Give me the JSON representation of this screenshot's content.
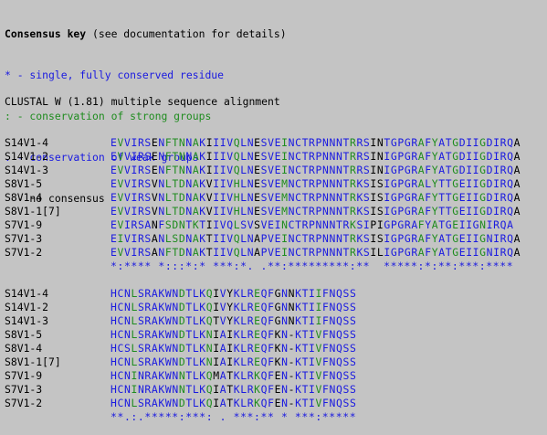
{
  "key": {
    "title": "Consensus key",
    "title_note": " (see documentation for details)",
    "items": [
      {
        "symbol": "*",
        "text": " - single, fully conserved residue",
        "color": "#1a1ae0"
      },
      {
        "symbol": ":",
        "text": " - conservation of strong groups",
        "color": "#1f8c1f"
      },
      {
        "symbol": ".",
        "text": " - conservation of weak groups",
        "color": "#1a1ae0"
      },
      {
        "symbol": " ",
        "text": " - no consensus",
        "color": "#000000"
      }
    ]
  },
  "alignment_header": "CLUSTAL W (1.81) multiple sequence alignment",
  "colors": {
    "identical": "#1a1ae0",
    "strong": "#1f8c1f",
    "plain": "#000000"
  },
  "blocks": [
    {
      "rows": [
        {
          "name": "S14V1-4",
          "seq": "EVVIRSENFTNNAKIIIVQLNESVEINCTRPNNNTRRSINTGPGRAFYATGDIIGDIRQA"
        },
        {
          "name": "S14V1-2",
          "seq": "EVVIRSENFTNNAKIIIVQLNESVEINCTRPNNNTRRSINIGPGRAFYATGDIIGDIRQA"
        },
        {
          "name": "S14V1-3",
          "seq": "EVVIRSENFTNNAKIIIVQLNESVEINCTRPNNNTRRSINIGPGRAFYATGDIIGDIRQA"
        },
        {
          "name": "S8V1-5",
          "seq": "EVVIRSVNLTDNAKVIIVHLNESVEMNCTRPNNNTRKSISIGPGRALYTTGEIIGDIRQA"
        },
        {
          "name": "S8V1-4",
          "seq": "EVVIRSVNLTDNAKVIIVHLNESVEMNCTRPNNNTRKSISIGPGRAFYTTGEIIGDIRQA"
        },
        {
          "name": "S8V1-1[7]",
          "seq": "EVVIRSVNLTDNAKVIIVHLNESVEMNCTRPNNNTRKSISIGPGRAFYTTGEIIGDIRQA"
        },
        {
          "name": "S7V1-9",
          "seq": "EVIRSANFSDNTKTIIVQLSVSVEINCTRPNNNTRKSIPIGPGRAFYATGEIIGNIRQA"
        },
        {
          "name": "S7V1-3",
          "seq": "EIVIRSANLSDNAKTIIVQLNAPVEINCTRPNNNTRKSISIGPGRAFYATGEIIGNIRQA"
        },
        {
          "name": "S7V1-2",
          "seq": "EVVIRSANFTDNAKTIIVQLNAPVEINCTRPNNNTRKSILIGPGRAFYATGEIIGNIRQA"
        }
      ],
      "consensus": "*:**** *:::*:* ***:*. .**:*********:**  *****:*:**:***:****"
    },
    {
      "rows": [
        {
          "name": "S14V1-4",
          "seq": "HCNLSRAKWNDTLKQIVYKLREQFGNNKTIIFNQSS"
        },
        {
          "name": "S14V1-2",
          "seq": "HCNLSRAKWNDTLKQIVYKLREQFGNNKTIIFNQSS"
        },
        {
          "name": "S14V1-3",
          "seq": "HCNLSRAKWNDTLKQTVYKLREQFGNNKTIIFNQSS"
        },
        {
          "name": "S8V1-5",
          "seq": "HCNLSRAKWNDTLKNIAIKLREQFKN-KTIVFNQSS"
        },
        {
          "name": "S8V1-4",
          "seq": "HCSLSRAKWNDTLKNIAIKLREQFKN-KTIVFNQSS"
        },
        {
          "name": "S8V1-1[7]",
          "seq": "HCNLSRAKWNDTLKNIAIKLREQFKN-KTIVFNQSS"
        },
        {
          "name": "S7V1-9",
          "seq": "HCNINRAKWNNTLKQMATKLRKQFEN-KTIVFNQSS"
        },
        {
          "name": "S7V1-3",
          "seq": "HCNINRAKWNNTLKQIATKLRKQFEN-KTIVFNQSS"
        },
        {
          "name": "S7V1-2",
          "seq": "HCNLSRAKWNDTLKQIATKLRKQFEN-KTIVFNQSS"
        }
      ],
      "consensus": "**.:.*****:***: . ***:** * ***:*****"
    }
  ]
}
